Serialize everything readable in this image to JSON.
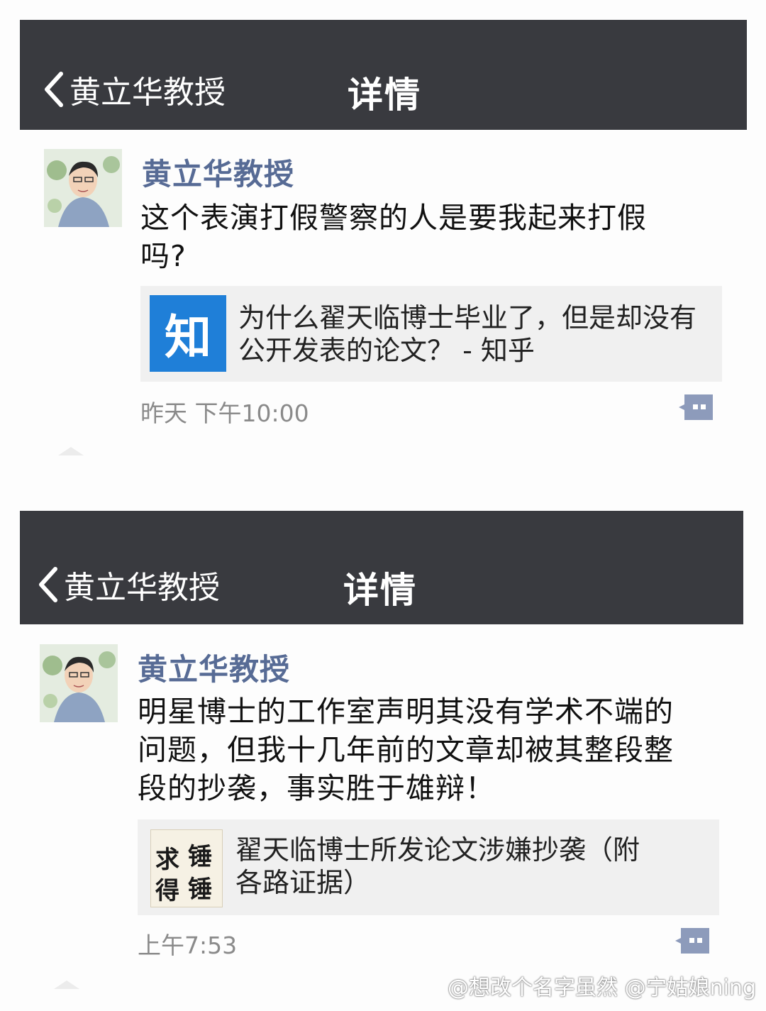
{
  "posts": [
    {
      "nav": {
        "back_label": "黄立华教授",
        "title": "详情"
      },
      "author": "黄立华教授",
      "text_lines": [
        "这个表演打假警察的人是要我起来打假",
        "吗?"
      ],
      "card": {
        "logo_text": "知",
        "title_lines": [
          "为什么翟天临博士毕业了，但是却没有",
          "公开发表的论文？ - 知乎"
        ]
      },
      "time": "昨天 下午10:00"
    },
    {
      "nav": {
        "back_label": "黄立华教授",
        "title": "详情"
      },
      "author": "黄立华教授",
      "text_lines": [
        "明星博士的工作室声明其没有学术不端的",
        "问题，但我十几年前的文章却被其整段整",
        "段的抄袭，事实胜于雄辩！"
      ],
      "card": {
        "logo_chars": [
          "求",
          "锤",
          "得",
          "锤"
        ],
        "title_lines": [
          "翟天临博士所发论文涉嫌抄袭（附",
          "各路证据）"
        ]
      },
      "time": "上午7:53"
    }
  ],
  "watermark": "@想改个名字虽然 @宁姑娘ning",
  "icons": [
    "chevron-left-icon",
    "comment-icon",
    "avatar"
  ],
  "colors": {
    "navbar": "#393a3f",
    "author": "#576b95",
    "zhihu_blue": "#1f7fd8",
    "comment_icon": "#8d9bbb"
  }
}
